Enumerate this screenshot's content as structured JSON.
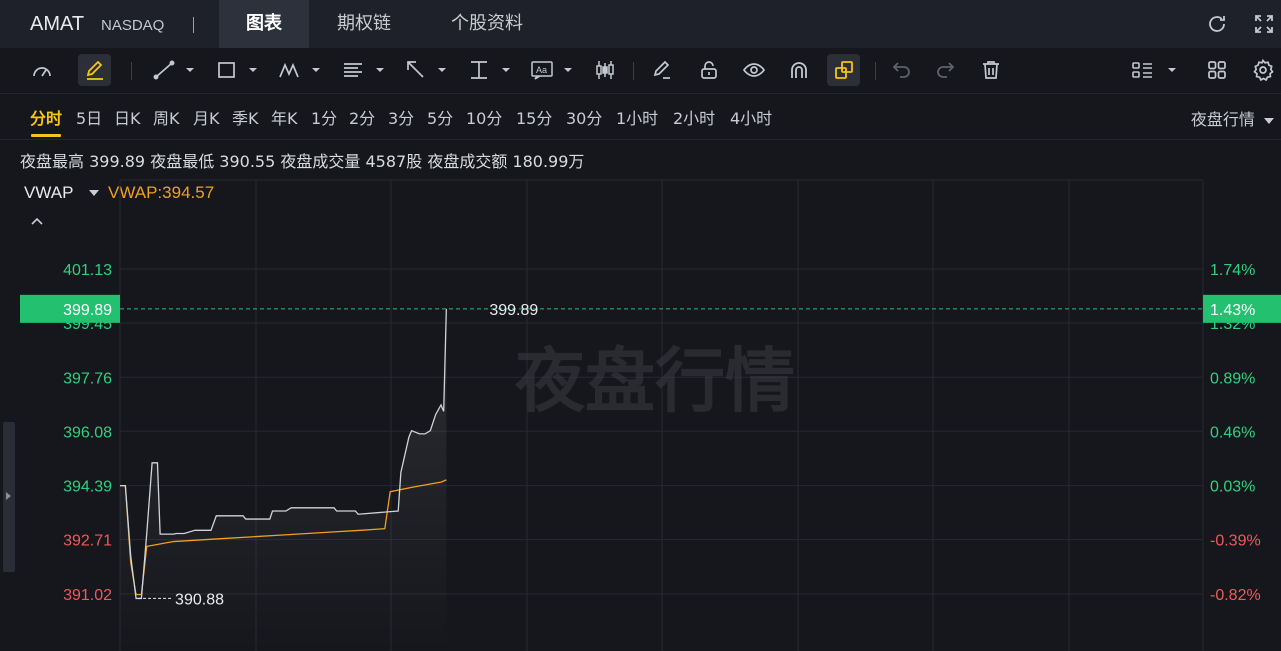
{
  "header": {
    "ticker": "AMAT",
    "exchange": "NASDAQ",
    "tabs": [
      {
        "label": "图表",
        "active": true
      },
      {
        "label": "期权链",
        "active": false
      },
      {
        "label": "个股资料",
        "active": false
      }
    ],
    "icons": [
      "refresh-icon",
      "fullscreen-icon"
    ]
  },
  "toolbar": {
    "tools": [
      "indicator-gauge-icon",
      "drawing-pencil-icon",
      "trend-line-icon",
      "rectangle-icon",
      "pattern-icon",
      "fibonacci-icon",
      "arrow-icon",
      "measure-icon",
      "text-annotation-icon",
      "candlestick-icon",
      "eraser-icon",
      "lock-icon",
      "eye-icon",
      "magnet-icon",
      "link-mode-icon",
      "undo-icon",
      "redo-icon",
      "trash-icon",
      "layout-list-icon",
      "grid-icon",
      "settings-icon"
    ],
    "text_tool_label": "Aa"
  },
  "periods": {
    "items": [
      "分时",
      "5日",
      "日K",
      "周K",
      "月K",
      "季K",
      "年K",
      "1分",
      "2分",
      "3分",
      "5分",
      "10分",
      "15分",
      "30分",
      "1小时",
      "2小时",
      "4小时"
    ],
    "active": "分时",
    "session_select": "夜盘行情"
  },
  "stats": {
    "high_label": "夜盘最高",
    "high_value": "399.89",
    "low_label": "夜盘最低",
    "low_value": "390.55",
    "volume_label": "夜盘成交量",
    "volume_value": "4587股",
    "turnover_label": "夜盘成交额",
    "turnover_value": "180.99万"
  },
  "indicator": {
    "name": "VWAP",
    "value_text": "VWAP:394.57"
  },
  "chart_data": {
    "type": "line",
    "watermark": "夜盘行情",
    "ylim": [
      390.2,
      402.6
    ],
    "x_range": [
      0,
      240
    ],
    "y_ticks": [
      {
        "value": 401.13,
        "label": "401.13",
        "pct": "1.74%"
      },
      {
        "value": 399.45,
        "label": "399.45",
        "pct": "1.32%"
      },
      {
        "value": 397.76,
        "label": "397.76",
        "pct": "0.89%"
      },
      {
        "value": 396.08,
        "label": "396.08",
        "pct": "0.46%"
      },
      {
        "value": 394.39,
        "label": "394.39",
        "pct": "0.03%"
      },
      {
        "value": 392.71,
        "label": "392.71",
        "pct": "-0.39%"
      },
      {
        "value": 391.02,
        "label": "391.02",
        "pct": "-0.82%"
      }
    ],
    "ref_price": 394.27,
    "colors": {
      "up": "#2fd180",
      "down": "#ef5a5a",
      "price": "#d0d3d8",
      "vwap": "#f0a020",
      "current": "#23c16f"
    },
    "current": {
      "value": 399.89,
      "label": "399.89",
      "pct": "1.43%"
    },
    "high_annotation": {
      "x": 61,
      "value": 399.89,
      "label": "399.89"
    },
    "low_annotation": {
      "x": 3,
      "value": 390.88,
      "label": "390.88"
    },
    "series": [
      {
        "name": "price",
        "x": [
          0,
          1,
          2,
          3,
          4,
          5,
          6,
          7,
          7.5,
          10,
          10.5,
          12,
          14,
          17,
          18,
          19,
          23,
          23.5,
          28,
          28.5,
          31,
          32,
          40,
          40.5,
          44,
          44.5,
          52,
          52.5,
          54,
          54.5,
          56,
          57,
          58,
          59,
          60,
          60.5,
          61
        ],
        "y": [
          394.39,
          394.39,
          392.2,
          390.88,
          390.88,
          392.9,
          395.1,
          395.1,
          392.88,
          392.88,
          392.9,
          392.9,
          393.0,
          393.0,
          393.45,
          393.45,
          393.45,
          393.35,
          393.35,
          393.6,
          393.6,
          393.7,
          393.7,
          393.6,
          393.6,
          393.5,
          393.6,
          394.8,
          395.9,
          396.1,
          396.0,
          396.0,
          396.1,
          396.6,
          396.9,
          396.7,
          399.89
        ]
      },
      {
        "name": "VWAP",
        "x": [
          0,
          1,
          2,
          3,
          4,
          5,
          10,
          15,
          20,
          25,
          30,
          40,
          45,
          49.5,
          50.5,
          55,
          60,
          61
        ],
        "y": [
          394.39,
          394.39,
          392.0,
          391.0,
          391.0,
          392.5,
          392.65,
          392.7,
          392.75,
          392.8,
          392.85,
          392.95,
          393.0,
          393.05,
          394.2,
          394.35,
          394.5,
          394.57
        ]
      }
    ]
  }
}
